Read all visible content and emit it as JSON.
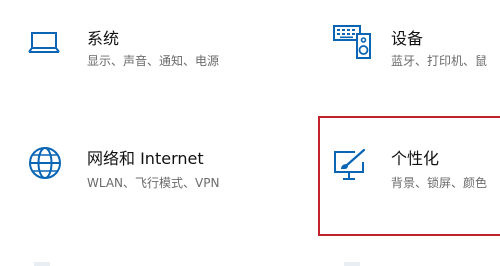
{
  "settings": {
    "tiles": [
      {
        "title": "系统",
        "desc": "显示、声音、通知、电源",
        "icon": "laptop-icon"
      },
      {
        "title": "设备",
        "desc": "蓝牙、打印机、鼠",
        "icon": "devices-icon"
      },
      {
        "title": "网络和 Internet",
        "desc": "WLAN、飞行模式、VPN",
        "icon": "globe-icon"
      },
      {
        "title": "个性化",
        "desc": "背景、锁屏、颜色",
        "icon": "personalization-icon"
      }
    ]
  },
  "colors": {
    "accent": "#0a66b5",
    "highlight_border": "#c0232a",
    "title_text": "#111111",
    "desc_text": "#6b6b6b"
  }
}
